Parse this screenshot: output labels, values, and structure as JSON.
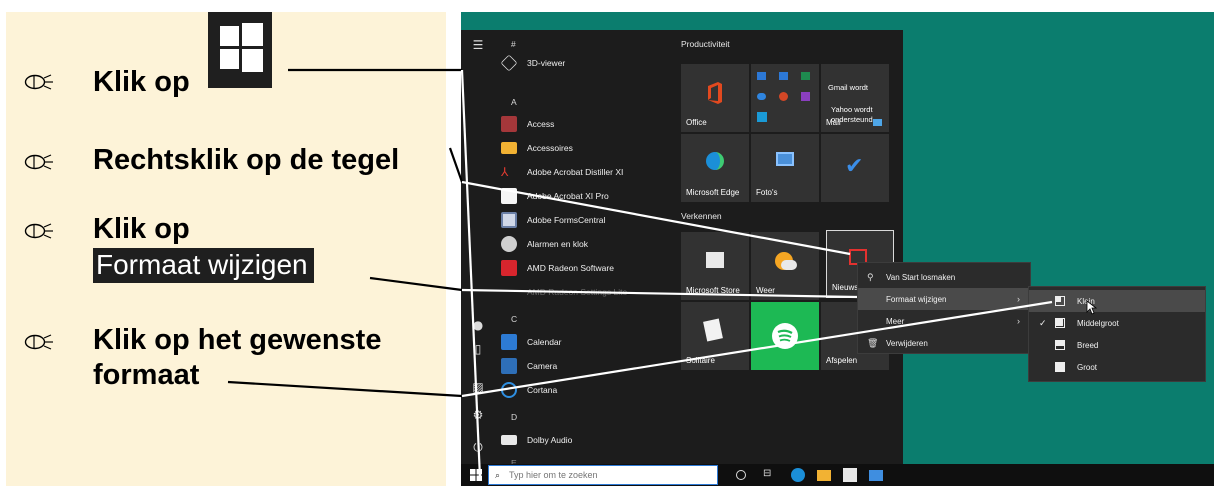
{
  "instructions": [
    {
      "text": "Klik op"
    },
    {
      "text": "Rechtsklik op de tegel"
    },
    {
      "text": "Klik op",
      "chip": "Formaat wijzigen"
    },
    {
      "line1": "Klik op het gewenste",
      "line2": "formaat"
    }
  ],
  "app_list": {
    "section_hash": "#",
    "letter_a": "A",
    "letter_c": "C",
    "letter_d": "D",
    "letter_e": "E",
    "apps": [
      {
        "label": "3D-viewer",
        "icon": "cube-icon"
      },
      {
        "label": "Access",
        "icon": "access-icon"
      },
      {
        "label": "Accessoires",
        "icon": "folder-icon"
      },
      {
        "label": "Adobe Acrobat Distiller XI",
        "icon": "acrobat-icon"
      },
      {
        "label": "Adobe Acrobat XI Pro",
        "icon": "acrobat-icon"
      },
      {
        "label": "Adobe FormsCentral",
        "icon": "forms-icon"
      },
      {
        "label": "Alarmen en klok",
        "icon": "clock-icon"
      },
      {
        "label": "AMD Radeon Software",
        "icon": "amd-icon"
      },
      {
        "label": "AMD Radeon Settings Lite",
        "icon": "amd-icon"
      },
      {
        "label": "Calendar",
        "icon": "calendar-icon"
      },
      {
        "label": "Camera",
        "icon": "camera-icon"
      },
      {
        "label": "Cortana",
        "icon": "cortana-icon"
      },
      {
        "label": "Dolby Audio",
        "icon": "dolby-icon"
      }
    ]
  },
  "groups": {
    "productivity": "Productiviteit",
    "explore": "Verkennen"
  },
  "tiles": {
    "office": "Office",
    "mail": "Mail",
    "mail_line1": "Gmail wordt",
    "mail_line2": "Yahoo wordt",
    "mail_line3": "ondersteund",
    "edge": "Microsoft Edge",
    "photos": "Foto's",
    "store": "Microsoft Store",
    "weather": "Weer",
    "news": "Nieuws",
    "solitaire": "Solitaire",
    "play": "Afspelen"
  },
  "context_menu": {
    "unpin": "Van Start losmaken",
    "resize": "Formaat wijzigen",
    "more": "Meer",
    "remove": "Verwijderen"
  },
  "size_menu": {
    "small": "Klein",
    "medium": "Middelgroot",
    "wide": "Breed",
    "large": "Groot",
    "checked": "Middelgroot"
  },
  "taskbar": {
    "search_placeholder": "Typ hier om te zoeken"
  },
  "colors": {
    "instruction_bg": "#fdf3d8",
    "desktop": "#0b7d6e",
    "start_menu": "#1c1c1c",
    "highlight_tile_border": "#d9d9d9",
    "search_border": "#2d7ad6"
  }
}
